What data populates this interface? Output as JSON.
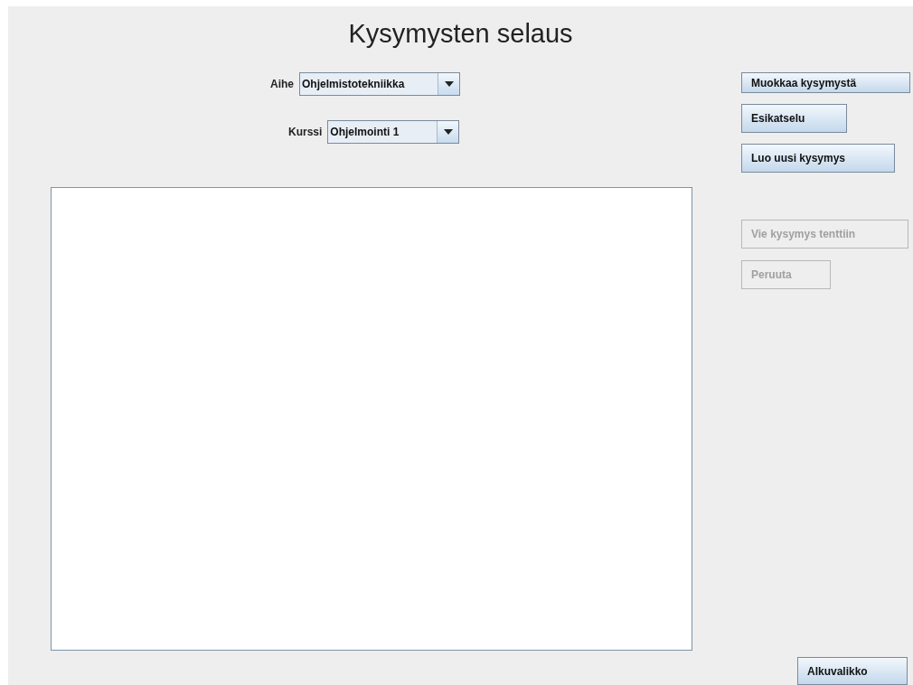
{
  "title": "Kysymysten selaus",
  "filters": [
    {
      "label": "Aihe",
      "value": "Ohjelmistotekniikka"
    },
    {
      "label": "Kurssi",
      "value": "Ohjelmointi 1"
    }
  ],
  "actions": [
    {
      "label": "Muokkaa kysymystä",
      "disabled": false
    },
    {
      "label": "Esikatselu",
      "disabled": false
    },
    {
      "label": "Luo uusi kysymys",
      "disabled": false
    },
    {
      "label": "Vie kysymys tenttiin",
      "disabled": true
    },
    {
      "label": "Peruuta",
      "disabled": true
    }
  ],
  "footer_button": {
    "label": "Alkuvalikko",
    "disabled": false
  }
}
